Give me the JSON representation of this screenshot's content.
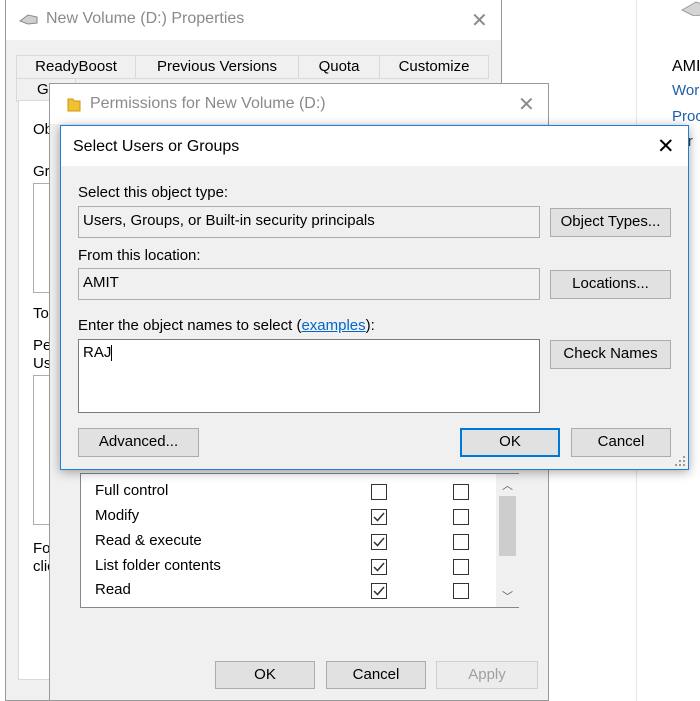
{
  "background": {
    "explorer_title": "AMI",
    "explorer_lines": [
      "Wor",
      "Proc",
      "ver"
    ]
  },
  "properties": {
    "title": "New Volume (D:) Properties",
    "tabs_row1": [
      "ReadyBoost",
      "Previous Versions",
      "Quota",
      "Customize"
    ],
    "tabs_row2": [
      "Ge"
    ],
    "side_labels": [
      "Ob",
      "Gro",
      "To",
      "Pe",
      "Us",
      "For",
      "clic"
    ]
  },
  "permissions": {
    "title": "Permissions for New Volume (D:)",
    "items": [
      {
        "label": "Full control",
        "allow": false,
        "deny": false
      },
      {
        "label": "Modify",
        "allow": true,
        "deny": false
      },
      {
        "label": "Read & execute",
        "allow": true,
        "deny": false
      },
      {
        "label": "List folder contents",
        "allow": true,
        "deny": false
      },
      {
        "label": "Read",
        "allow": true,
        "deny": false
      }
    ],
    "ok_label": "OK",
    "cancel_label": "Cancel",
    "apply_label": "Apply"
  },
  "select_dialog": {
    "title": "Select Users or Groups",
    "object_type_label": "Select this object type:",
    "object_type_value": "Users, Groups, or Built-in security principals",
    "object_types_button": "Object Types...",
    "location_label": "From this location:",
    "location_value": "AMIT",
    "locations_button": "Locations...",
    "names_label_prefix": "Enter the object names to select (",
    "names_label_link": "examples",
    "names_label_suffix": "):",
    "names_value": "RAJ",
    "check_names_button": "Check Names",
    "advanced_button": "Advanced...",
    "ok_label": "OK",
    "cancel_label": "Cancel"
  }
}
